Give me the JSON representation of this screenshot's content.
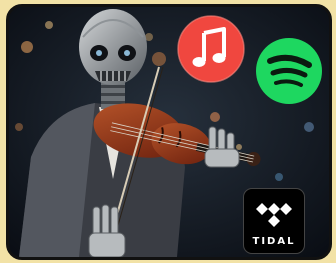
{
  "image": {
    "subject": "robot-violinist",
    "border_color": "#111111",
    "background_color": "#f2e2a6"
  },
  "icons": {
    "apple_music": {
      "icon": "apple-music-note-icon",
      "color": "#f0473f"
    },
    "spotify": {
      "icon": "spotify-logo-icon",
      "color": "#1ed760"
    },
    "tidal": {
      "icon": "tidal-logo-icon",
      "label": "TIDAL",
      "color": "#000000"
    }
  }
}
